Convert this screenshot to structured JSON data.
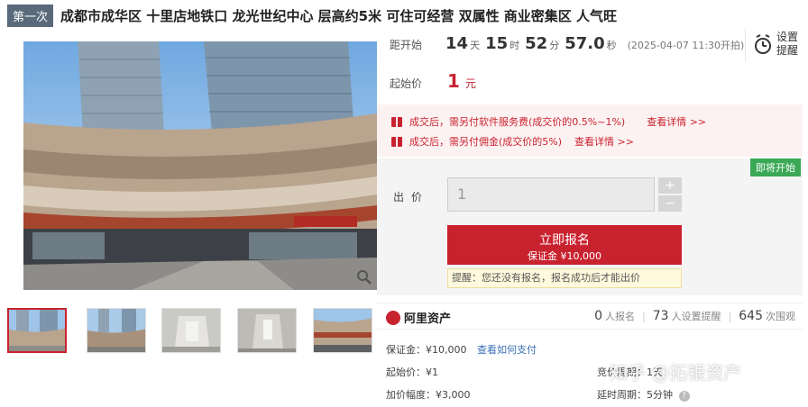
{
  "header": {
    "round_badge": "第一次",
    "title": "成都市成华区 十里店地铁口 龙光世纪中心 层高约5米 可住可经营 双属性 商业密集区 人气旺"
  },
  "countdown": {
    "label": "距开始",
    "days": "14",
    "days_unit": "天",
    "hours": "15",
    "hours_unit": "时",
    "minutes": "52",
    "minutes_unit": "分",
    "seconds": "57.0",
    "seconds_unit": "秒",
    "start_time": "(2025-04-07 11:30开拍)"
  },
  "reminder": {
    "line1": "设置",
    "line2": "提醒",
    "icon": "alarm-clock-icon"
  },
  "start_price": {
    "label": "起始价",
    "value": "1",
    "unit": "元"
  },
  "fees": [
    {
      "text": "成交后，需另付软件服务费(成交价的0.5%~1%)",
      "link": "查看详情 >>"
    },
    {
      "text": "成交后，需另付佣金(成交价的5%)",
      "link": "查看详情 >>"
    }
  ],
  "bid": {
    "status_badge": "即将开始",
    "label": "出价",
    "input_value": "1",
    "plus": "+",
    "minus": "−",
    "signup_label": "立即报名",
    "deposit_label": "保证金 ¥10,000",
    "hint": "提醒：您还没有报名，报名成功后才能出价"
  },
  "platform": {
    "name": "阿里资产",
    "signups": "0",
    "signups_label": "人报名",
    "reminders": "73",
    "reminders_label": "人设置提醒",
    "views": "645",
    "views_label": "次围观"
  },
  "info": {
    "deposit": "保证金：¥10,000",
    "pay_link": "查看如何支付",
    "start_price": "起始价：¥1",
    "increment": "加价幅度：¥3,000",
    "cycle_partial": "竞价周期：1天",
    "delay": "延时周期：5分钟"
  },
  "watermark": "知乎 @拓银资产",
  "colors": {
    "accent": "#c9222f",
    "success": "#3aa855",
    "link": "#3a6fb5",
    "badge_bg": "#5a6a7a"
  }
}
